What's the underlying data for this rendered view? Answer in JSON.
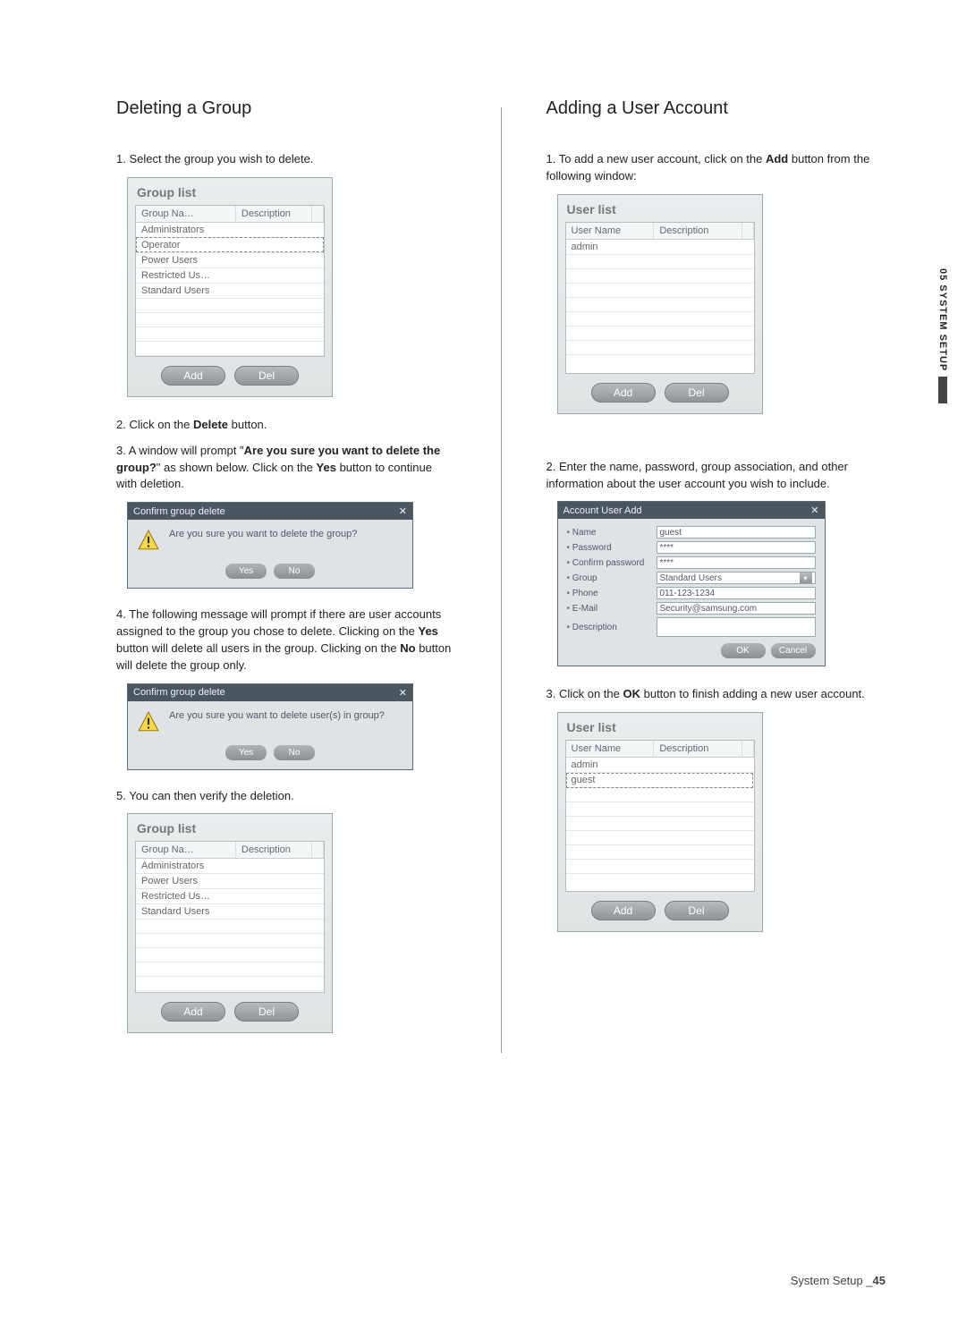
{
  "left": {
    "heading": "Deleting a Group",
    "step1": "1. Select the group you wish to delete.",
    "panel1": {
      "title": "Group list",
      "col1": "Group Na…",
      "col2": "Description",
      "rows": [
        "Administrators",
        "Operator",
        "Power Users",
        "Restricted Us…",
        "Standard Users"
      ],
      "selected_row": "Operator",
      "add": "Add",
      "del": "Del"
    },
    "step2_a": "2. Click on the ",
    "step2_bold": "Delete",
    "step2_b": " button.",
    "step3_a": "3. A window will prompt \"",
    "step3_bold1": "Are you sure you want to delete the group?",
    "step3_b": "\" as shown below. Click on the ",
    "step3_bold2": "Yes",
    "step3_c": " button to continue with deletion.",
    "dialog1": {
      "title": "Confirm group delete",
      "msg": "Are you sure you want to delete the group?",
      "yes": "Yes",
      "no": "No"
    },
    "step4_a": "4. The following message will prompt if there are user accounts assigned to the group you chose to delete. Clicking on the ",
    "step4_bold1": "Yes",
    "step4_b": " button will delete all users in the group. Clicking on the ",
    "step4_bold2": "No",
    "step4_c": " button will delete the group only.",
    "dialog2": {
      "title": "Confirm group delete",
      "msg": "Are you sure you want to delete user(s) in group?",
      "yes": "Yes",
      "no": "No"
    },
    "step5": "5. You can then verify the deletion.",
    "panel2": {
      "title": "Group list",
      "col1": "Group Na…",
      "col2": "Description",
      "rows": [
        "Administrators",
        "Power Users",
        "Restricted Us…",
        "Standard Users"
      ],
      "add": "Add",
      "del": "Del"
    }
  },
  "right": {
    "heading": "Adding a User Account",
    "step1_a": "1. To add a new user account, click on the ",
    "step1_bold": "Add",
    "step1_b": " button from the following window:",
    "panel1": {
      "title": "User list",
      "col1": "User Name",
      "col2": "Description",
      "rows": [
        "admin"
      ],
      "add": "Add",
      "del": "Del"
    },
    "step2": "2. Enter the name, password, group association, and other information about the user account you wish to include.",
    "form": {
      "title": "Account User Add",
      "labels": {
        "name": "Name",
        "password": "Password",
        "confirm": "Confirm password",
        "group": "Group",
        "phone": "Phone",
        "email": "E-Mail",
        "description": "Description"
      },
      "values": {
        "name": "guest",
        "password": "****",
        "confirm": "****",
        "group": "Standard Users",
        "phone": "011-123-1234",
        "email": "Security@samsung.com",
        "description": ""
      },
      "ok": "OK",
      "cancel": "Cancel"
    },
    "step3_a": "3. Click on the ",
    "step3_bold": "OK",
    "step3_b": " button to finish adding a new user account.",
    "panel2": {
      "title": "User list",
      "col1": "User Name",
      "col2": "Description",
      "rows": [
        "admin",
        "guest"
      ],
      "selected_row": "guest",
      "add": "Add",
      "del": "Del"
    }
  },
  "side_tab": "05 SYSTEM SETUP",
  "footer_label": "System Setup _",
  "footer_page": "45"
}
